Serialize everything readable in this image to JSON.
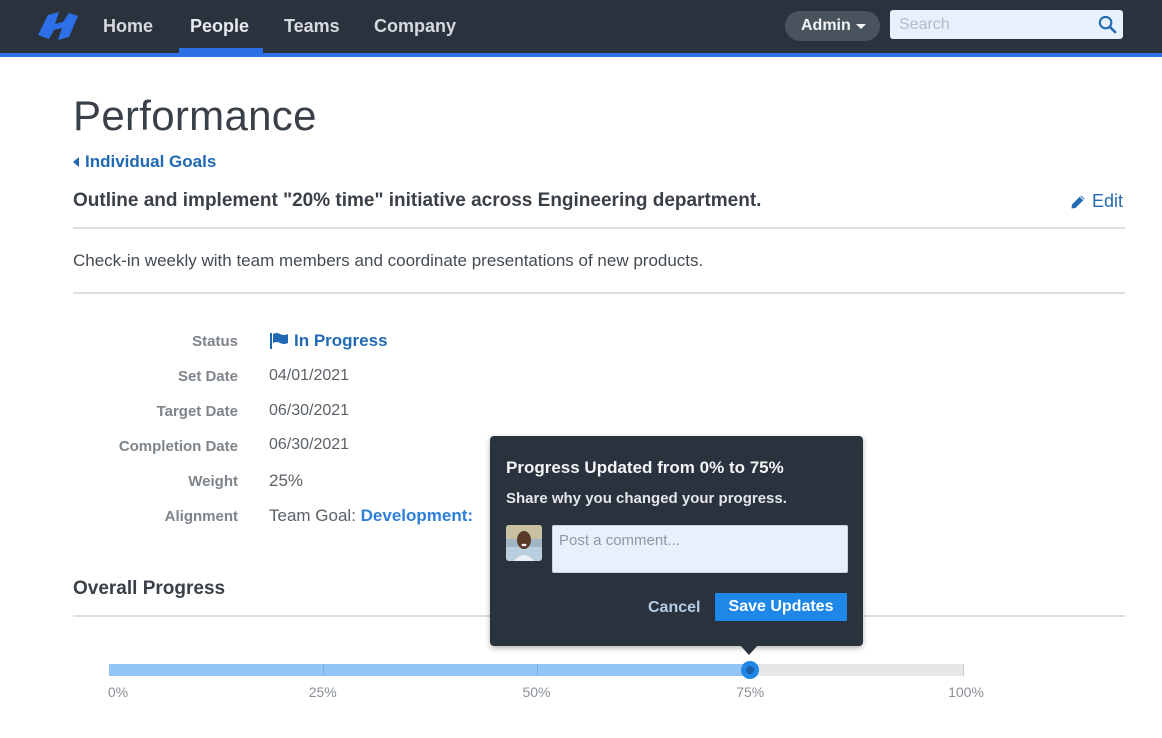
{
  "nav": {
    "logo": "brand-logo",
    "items": [
      {
        "label": "Home",
        "active": false
      },
      {
        "label": "People",
        "active": true
      },
      {
        "label": "Teams",
        "active": false
      },
      {
        "label": "Company",
        "active": false
      }
    ],
    "admin_label": "Admin",
    "search_placeholder": "Search",
    "accent_color": "#2d6fe6"
  },
  "page": {
    "title": "Performance",
    "breadcrumb": "Individual Goals",
    "goal_title": "Outline and implement \"20% time\" initiative across Engineering department.",
    "edit_label": "Edit",
    "goal_description": "Check-in weekly with team members and coordinate presentations of new products."
  },
  "details": {
    "status_label": "Status",
    "status_value": "In Progress",
    "set_date_label": "Set Date",
    "set_date_value": "04/01/2021",
    "target_date_label": "Target Date",
    "target_date_value": "06/30/2021",
    "completion_date_label": "Completion Date",
    "completion_date_value": "06/30/2021",
    "weight_label": "Weight",
    "weight_value": "25%",
    "alignment_label": "Alignment",
    "alignment_prefix": "Team Goal: ",
    "alignment_link": "Development:"
  },
  "progress": {
    "section_title": "Overall Progress",
    "value_percent": 75,
    "ticks": [
      "0%",
      "25%",
      "50%",
      "75%",
      "100%"
    ]
  },
  "popover": {
    "title": "Progress Updated from 0% to 75%",
    "subtitle": "Share why you changed your progress.",
    "comment_placeholder": "Post a comment...",
    "comment_value": "",
    "cancel_label": "Cancel",
    "save_label": "Save Updates"
  }
}
